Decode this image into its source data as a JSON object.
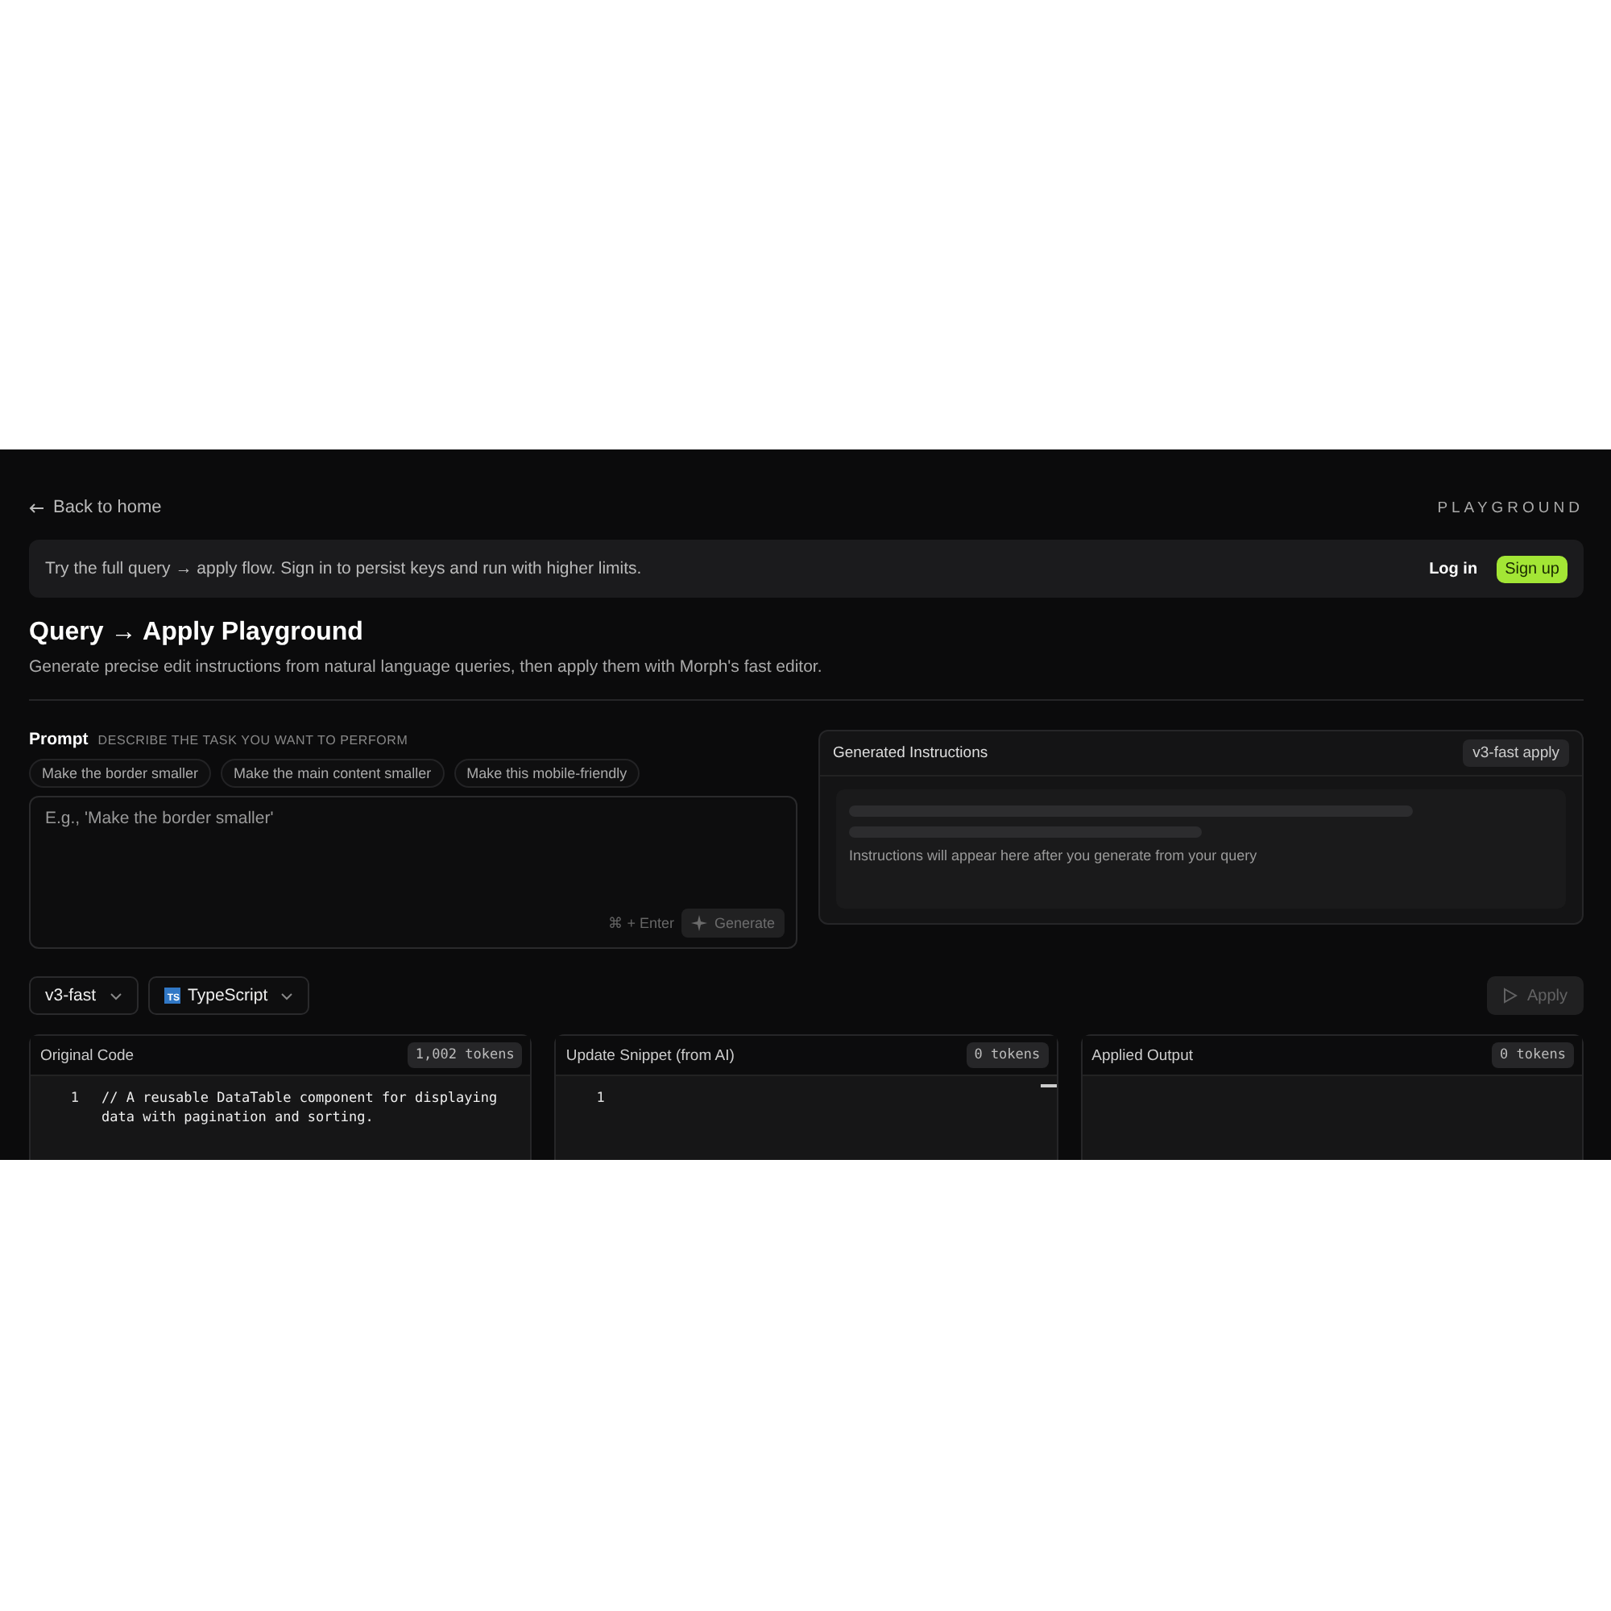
{
  "header": {
    "back_link": "Back to home",
    "section_label": "PLAYGROUND"
  },
  "banner": {
    "text": "Try the full query → apply flow. Sign in to persist keys and run with higher limits.",
    "login": "Log in",
    "signup": "Sign up"
  },
  "title": "Query → Apply Playground",
  "subtitle": "Generate precise edit instructions from natural language queries, then apply them with Morph's fast editor.",
  "prompt": {
    "label": "Prompt",
    "hint": "DESCRIBE THE TASK YOU WANT TO PERFORM",
    "suggestions": [
      "Make the border smaller",
      "Make the main content smaller",
      "Make this mobile-friendly"
    ],
    "placeholder": "E.g., 'Make the border smaller'",
    "shortcut": "⌘ + Enter",
    "generate": {
      "label": "Generate",
      "disabled": true
    }
  },
  "instructions": {
    "title": "Generated Instructions",
    "badge": "v3-fast apply",
    "loading": true,
    "empty_text": "Instructions will appear here after you generate from your query"
  },
  "toolbar": {
    "model": "v3-fast",
    "language": "TypeScript",
    "language_icon": "TS",
    "apply": {
      "label": "Apply",
      "disabled": true
    }
  },
  "panels": [
    {
      "title": "Original Code",
      "tokens": "1,002 tokens",
      "lines": [
        {
          "number": "1",
          "text": "// A reusable DataTable component for displaying data with pagination and sorting."
        }
      ],
      "cursor": false
    },
    {
      "title": "Update Snippet (from AI)",
      "tokens": "0 tokens",
      "lines": [
        {
          "number": "1"
        }
      ],
      "cursor": true
    },
    {
      "title": "Applied Output",
      "tokens": "0 tokens",
      "cursor": false
    }
  ]
}
